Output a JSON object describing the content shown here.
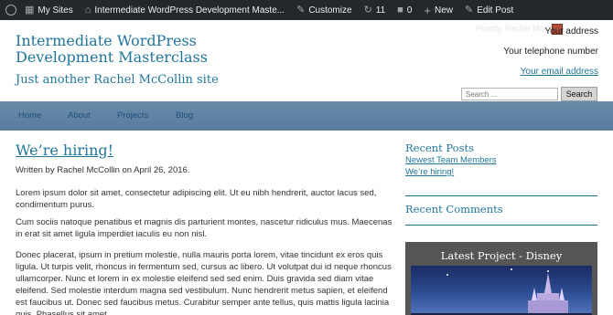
{
  "adminbar": {
    "my_sites": "My Sites",
    "site_name": "Intermediate WordPress Development Maste...",
    "customize": "Customize",
    "updates_count": "11",
    "comments_count": "0",
    "new": "New",
    "edit_post": "Edit Post",
    "howdy": "Howdy, Rachel McCollin"
  },
  "header": {
    "site_title": "Intermediate WordPress Development Masterclass",
    "site_description": "Just another Rachel McCollin site",
    "address": "Your address",
    "phone": "Your telephone number",
    "email": "Your email address"
  },
  "search": {
    "placeholder": "Search ...",
    "button": "Search"
  },
  "nav": {
    "items": [
      "Home",
      "About",
      "Projects",
      "Blog"
    ]
  },
  "post": {
    "title": "We’re hiring!",
    "byline": "Written by Rachel McCollin on April 26, 2016.",
    "paragraphs": [
      "Lorem ipsum dolor sit amet, consectetur adipiscing elit. Ut eu nibh hendrerit, auctor lacus sed, condimentum purus.",
      "Cum sociis natoque penatibus et magnis dis parturient montes, nascetur ridiculus mus. Maecenas in erat sit amet ligula imperdiet iaculis eu non nisl.",
      "Donec placerat, ipsum in pretium molestie, nulla mauris porta lorem, vitae tincidunt ex eros quis ligula. Ut turpis velit, rhoncus in fermentum sed, cursus ac libero. Ut volutpat dui id neque rhoncus ullamcorper. Nunc et lorem in ex molestie eleifend sed sed enim. Duis gravida sed diam vitae eleifend. Sed molestie interdum magna sed vestibulum. Nunc hendrerit metus sapien, et eleifend est faucibus ut. Donec sed faucibus metus. Curabitur semper ante tellus, quis mattis ligula lacinia quis. Phasellus sit amet"
    ]
  },
  "sidebar": {
    "recent_posts_title": "Recent Posts",
    "recent_posts": [
      "Newest Team Members",
      "We’re hiring!"
    ],
    "recent_comments_title": "Recent Comments",
    "widget_title": "Latest Project - Disney"
  },
  "colors": {
    "link": "#21759b",
    "adminbar": "#23282d",
    "nav": "#6a8cab"
  }
}
